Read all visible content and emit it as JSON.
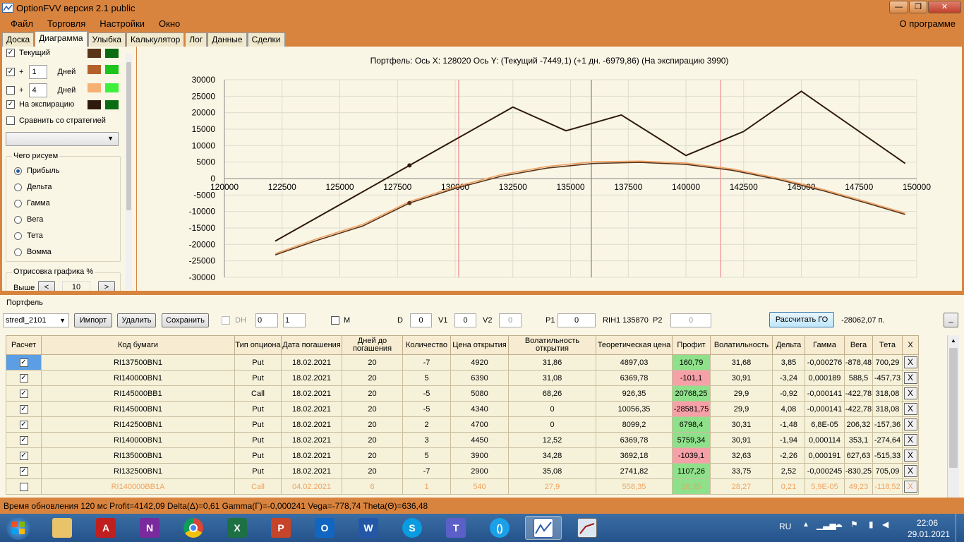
{
  "window": {
    "title": "OptionFVV версия 2.1 public",
    "minimize": "—",
    "maximize": "❐",
    "close": "✕"
  },
  "menu": {
    "items": [
      "Файл",
      "Торговля",
      "Настройки",
      "Окно"
    ],
    "about": "О программе"
  },
  "tabs": [
    "Доска",
    "Диаграмма",
    "Улыбка",
    "Калькулятор",
    "Лог",
    "Данные",
    "Сделки"
  ],
  "left_panel": {
    "current_label": "Текущий",
    "plus": "+",
    "days_label": "Дней",
    "days1": "1",
    "days2": "4",
    "expiry_label": "На экспирацию",
    "compare_label": "Сравнить со стратегией",
    "group_title": "Чего рисуем",
    "radios": [
      "Прибыль",
      "Дельта",
      "Гамма",
      "Вега",
      "Тета",
      "Вомма"
    ],
    "draw_title": "Отрисовка графика %",
    "above_label": "Выше",
    "above_value": "10",
    "dec": "<",
    "inc": ">",
    "colors": {
      "current": [
        "#5a3418",
        "#0b6b12"
      ],
      "days1": [
        "#b3612a",
        "#1ec41e"
      ],
      "days2": [
        "#f6b073",
        "#3cf03c"
      ],
      "expiry": [
        "#2e1a0c",
        "#0b6b12"
      ]
    }
  },
  "chart_header": "Портфель: Ось X: 128020 Ось Y:  (Текущий -7449,1)  (+1 дн. -6979,86)  (На экспирацию 3990)",
  "chart_data": {
    "type": "line",
    "xlim": [
      120000,
      150000
    ],
    "ylim": [
      -30000,
      30000
    ],
    "x_ticks": [
      "120000",
      "122500",
      "125000",
      "127500",
      "130000",
      "132500",
      "135000",
      "137500",
      "140000",
      "142500",
      "145000",
      "147500",
      "150000"
    ],
    "y_ticks": [
      "30000",
      "25000",
      "20000",
      "15000",
      "10000",
      "5000",
      "0",
      "-5000",
      "-10000",
      "-15000",
      "-20000",
      "-25000",
      "-30000"
    ],
    "grid": true,
    "cursor_x": 128020,
    "vertical_lines": [
      {
        "x": 135900,
        "color": "#8a9aa0"
      },
      {
        "x": 130150,
        "color": "#f0a0a0"
      },
      {
        "x": 141500,
        "color": "#f0a0a0"
      }
    ],
    "series": [
      {
        "color": "#2e1a0c",
        "values": [
          [
            122200,
            -19000
          ],
          [
            128020,
            3990
          ],
          [
            132500,
            21700
          ],
          [
            134800,
            14500
          ],
          [
            137200,
            19300
          ],
          [
            140000,
            7000
          ],
          [
            142500,
            14300
          ],
          [
            145000,
            26500
          ],
          [
            149500,
            4600
          ]
        ]
      },
      {
        "color": "#5a3418",
        "values": [
          [
            122200,
            -23200
          ],
          [
            124000,
            -18800
          ],
          [
            126000,
            -14400
          ],
          [
            128020,
            -7449
          ],
          [
            130000,
            -3000
          ],
          [
            132000,
            700
          ],
          [
            134000,
            3200
          ],
          [
            136000,
            4600
          ],
          [
            138000,
            4900
          ],
          [
            140000,
            4300
          ],
          [
            142000,
            2500
          ],
          [
            144000,
            -300
          ],
          [
            146000,
            -3800
          ],
          [
            148000,
            -7800
          ],
          [
            149500,
            -10900
          ]
        ]
      },
      {
        "color": "#f0a060",
        "values": [
          [
            122200,
            -22800
          ],
          [
            124000,
            -18300
          ],
          [
            126000,
            -13900
          ],
          [
            128020,
            -6980
          ],
          [
            130000,
            -2500
          ],
          [
            132000,
            1200
          ],
          [
            134000,
            3700
          ],
          [
            136000,
            5100
          ],
          [
            138000,
            5300
          ],
          [
            140000,
            4700
          ],
          [
            142000,
            2900
          ],
          [
            144000,
            100
          ],
          [
            146000,
            -3400
          ],
          [
            148000,
            -7400
          ],
          [
            149500,
            -10500
          ]
        ]
      }
    ]
  },
  "portfolio": {
    "label": "Портфель",
    "select_value": "stredl_2101",
    "import": "Импорт",
    "delete": "Удалить",
    "save": "Сохранить",
    "dh": "DH",
    "spin1": "0",
    "spin2": "1",
    "m": "M",
    "d_label": "D",
    "d_value": "0",
    "v1_label": "V1",
    "v1_value": "0",
    "v2_label": "V2",
    "v2_value": "0",
    "p1_label": "P1",
    "p1_value": "0",
    "rih": "RIH1 135870",
    "p2_label": "P2",
    "p2_value": "0",
    "calc": "Рассчитать ГО",
    "margin": "-28062,07 п.",
    "small_btn": "_"
  },
  "table": {
    "headers": [
      "Расчет",
      "Код бумаги",
      "Тип опциона",
      "Дата погашения",
      "Дней до погашения",
      "Количество",
      "Цена открытия",
      "Волатильность открытия",
      "Теоретическая цена",
      "Профит",
      "Волатильность",
      "Дельта",
      "Гамма",
      "Вега",
      "Тета",
      "X"
    ],
    "rows": [
      {
        "check": "✓",
        "code": "RI137500BN1",
        "type": "Put",
        "date": "18.02.2021",
        "days": "20",
        "qty": "-7",
        "open": "4920",
        "vol_open": "31,86",
        "theor": "4897,03",
        "profit": "160,79",
        "profit_sign": "pos",
        "vol": "31,68",
        "delta": "3,85",
        "gamma": "-0,000276",
        "vega": "-878,48",
        "theta": "700,29",
        "x": "X"
      },
      {
        "check": "✓",
        "code": "RI140000BN1",
        "type": "Put",
        "date": "18.02.2021",
        "days": "20",
        "qty": "5",
        "open": "6390",
        "vol_open": "31,08",
        "theor": "6369,78",
        "profit": "-101,1",
        "profit_sign": "neg",
        "vol": "30,91",
        "delta": "-3,24",
        "gamma": "0,000189",
        "vega": "588,5",
        "theta": "-457,73",
        "x": "X"
      },
      {
        "check": "✓",
        "code": "RI145000BB1",
        "type": "Call",
        "date": "18.02.2021",
        "days": "20",
        "qty": "-5",
        "open": "5080",
        "vol_open": "68,26",
        "theor": "926,35",
        "profit": "20768,25",
        "profit_sign": "pos",
        "vol": "29,9",
        "delta": "-0,92",
        "gamma": "-0,000141",
        "vega": "-422,78",
        "theta": "318,08",
        "x": "X"
      },
      {
        "check": "✓",
        "code": "RI145000BN1",
        "type": "Put",
        "date": "18.02.2021",
        "days": "20",
        "qty": "-5",
        "open": "4340",
        "vol_open": "0",
        "theor": "10056,35",
        "profit": "-28581,75",
        "profit_sign": "neg",
        "vol": "29,9",
        "delta": "4,08",
        "gamma": "-0,000141",
        "vega": "-422,78",
        "theta": "318,08",
        "x": "X"
      },
      {
        "check": "✓",
        "code": "RI142500BN1",
        "type": "Put",
        "date": "18.02.2021",
        "days": "20",
        "qty": "2",
        "open": "4700",
        "vol_open": "0",
        "theor": "8099,2",
        "profit": "6798,4",
        "profit_sign": "pos",
        "vol": "30,31",
        "delta": "-1,48",
        "gamma": "6,8E-05",
        "vega": "206,32",
        "theta": "-157,36",
        "x": "X"
      },
      {
        "check": "✓",
        "code": "RI140000BN1",
        "type": "Put",
        "date": "18.02.2021",
        "days": "20",
        "qty": "3",
        "open": "4450",
        "vol_open": "12,52",
        "theor": "6369,78",
        "profit": "5759,34",
        "profit_sign": "pos",
        "vol": "30,91",
        "delta": "-1,94",
        "gamma": "0,000114",
        "vega": "353,1",
        "theta": "-274,64",
        "x": "X"
      },
      {
        "check": "✓",
        "code": "RI135000BN1",
        "type": "Put",
        "date": "18.02.2021",
        "days": "20",
        "qty": "5",
        "open": "3900",
        "vol_open": "34,28",
        "theor": "3692,18",
        "profit": "-1039,1",
        "profit_sign": "neg",
        "vol": "32,63",
        "delta": "-2,26",
        "gamma": "0,000191",
        "vega": "627,63",
        "theta": "-515,33",
        "x": "X"
      },
      {
        "check": "✓",
        "code": "RI132500BN1",
        "type": "Put",
        "date": "18.02.2021",
        "days": "20",
        "qty": "-7",
        "open": "2900",
        "vol_open": "35,08",
        "theor": "2741,82",
        "profit": "1107,26",
        "profit_sign": "pos",
        "vol": "33,75",
        "delta": "2,52",
        "gamma": "-0,000245",
        "vega": "-830,25",
        "theta": "705,09",
        "x": "X"
      },
      {
        "check": "",
        "code": "RI140000BB1A",
        "type": "Call",
        "date": "04.02.2021",
        "days": "6",
        "qty": "1",
        "open": "540",
        "vol_open": "27,9",
        "theor": "558,35",
        "profit": "18,35",
        "profit_sign": "pos",
        "vol": "28,27",
        "delta": "0,21",
        "gamma": "5,9E-05",
        "vega": "49,23",
        "theta": "-118,52",
        "x": "X"
      }
    ]
  },
  "status": "Время обновления 120 мс  Profit=4142,09 Delta(Δ)=0,61 Gamma(Γ)=-0,000241 Vega=-778,74 Theta(Θ)=636,48",
  "taskbar": {
    "apps": [
      {
        "name": "start",
        "label": ""
      },
      {
        "name": "explorer",
        "label": ""
      },
      {
        "name": "acrobat",
        "label": "A"
      },
      {
        "name": "onenote",
        "label": "N"
      },
      {
        "name": "chrome",
        "label": ""
      },
      {
        "name": "excel",
        "label": "X"
      },
      {
        "name": "powerpoint",
        "label": "P"
      },
      {
        "name": "outlook",
        "label": "O"
      },
      {
        "name": "word",
        "label": "W"
      },
      {
        "name": "skype",
        "label": "S"
      },
      {
        "name": "teams",
        "label": "T"
      },
      {
        "name": "app-c",
        "label": "()"
      },
      {
        "name": "optionfvv",
        "label": ""
      },
      {
        "name": "app-chart2",
        "label": ""
      }
    ],
    "lang": "RU",
    "time": "22:06",
    "date": "29.01.2021"
  }
}
